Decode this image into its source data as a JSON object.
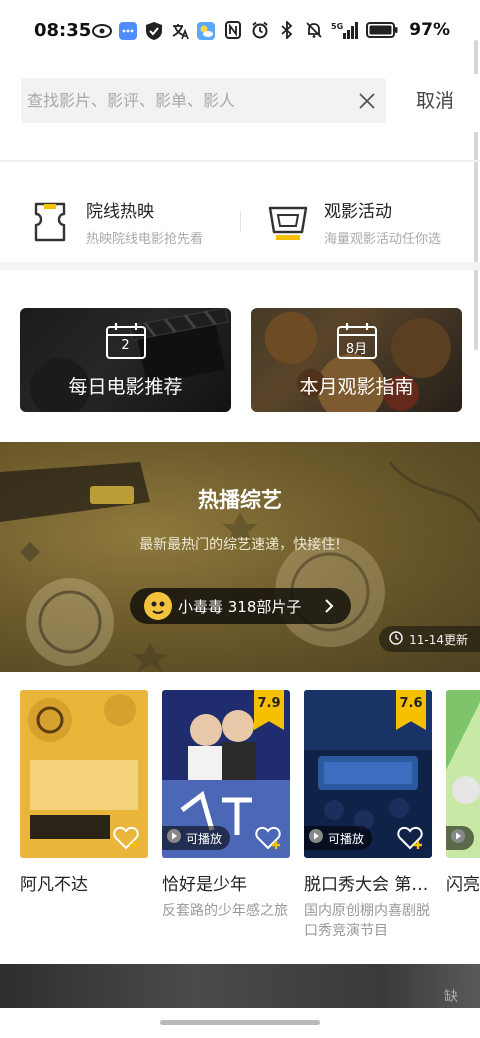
{
  "status": {
    "time": "08:35",
    "battery": "97%",
    "net": "5G"
  },
  "search": {
    "placeholder": "查找影片、影评、影单、影人",
    "value": "",
    "cancel": "取消"
  },
  "quick_entries": [
    {
      "title": "院线热映",
      "subtitle": "热映院线电影抢先看",
      "icon": "ticket-icon"
    },
    {
      "title": "观影活动",
      "subtitle": "海量观影活动任你选",
      "icon": "screen-icon"
    }
  ],
  "cards": [
    {
      "calendar": "2",
      "title": "每日电影推荐"
    },
    {
      "calendar": "8月",
      "title": "本月观影指南"
    }
  ],
  "banner": {
    "title": "热播综艺",
    "subtitle": "最新最热门的综艺速递，快接住!",
    "author": "小毒毒  318部片子",
    "update": "11-14更新"
  },
  "shows": [
    {
      "title": "阿凡不达",
      "score": "",
      "playable": "",
      "desc": "",
      "colors": [
        "#e9b53a",
        "#c08f1f"
      ]
    },
    {
      "title": "恰好是少年",
      "score": "7.9",
      "playable": "可播放",
      "desc": "反套路的少年感之旅",
      "colors": [
        "#1f2d6e",
        "#4b67b5"
      ]
    },
    {
      "title": "脱口秀大会 第…",
      "score": "7.6",
      "playable": "可播放",
      "desc": "国内原创棚内喜剧脱口秀竞演节目",
      "colors": [
        "#0f2247",
        "#2c5aa0"
      ]
    },
    {
      "title": "闪亮",
      "score": "",
      "playable": "",
      "desc": "",
      "colors": [
        "#7dc46a",
        "#c8e8a5"
      ]
    }
  ],
  "bottom": {
    "mark": "缺"
  },
  "colors": {
    "accent": "#f5c000",
    "banner": "#6e5c2c"
  }
}
